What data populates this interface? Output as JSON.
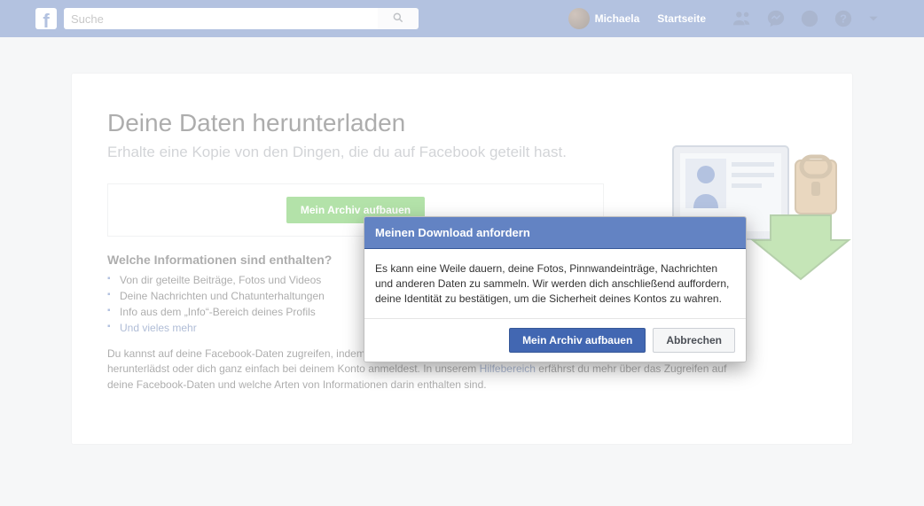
{
  "header": {
    "search_placeholder": "Suche",
    "profile_name": "Michaela",
    "home_label": "Startseite"
  },
  "page": {
    "title": "Deine Daten herunterladen",
    "subtitle": "Erhalte eine Kopie von den Dingen, die du auf Facebook geteilt hast.",
    "archive_button": "Mein Archiv aufbauen",
    "section_heading": "Welche Informationen sind enthalten?",
    "bullets": [
      "Von dir geteilte Beiträge, Fotos und Videos",
      "Deine Nachrichten und Chatunterhaltungen",
      "Info aus dem „Info“-Bereich deines Profils"
    ],
    "bullet_link": "Und vieles mehr",
    "para_part1": "Du kannst auf deine Facebook-Daten zugreifen, indem du dich bei Facebook anmeldest und ein Archiv deiner Informationen herunterlädst oder dich ganz einfach bei deinem Konto anmeldest. In unserem ",
    "para_link": "Hilfebereich",
    "para_part2": " erfährst du mehr über das Zugreifen auf deine Facebook-Daten und welche Arten von Informationen darin enthalten sind."
  },
  "dialog": {
    "title": "Meinen Download anfordern",
    "body": "Es kann eine Weile dauern, deine Fotos, Pinnwandeinträge, Nachrichten und anderen Daten zu sammeln. Wir werden dich anschließend auffordern, deine Identität zu bestätigen, um die Sicherheit deines Kontos zu wahren.",
    "confirm": "Mein Archiv aufbauen",
    "cancel": "Abbrechen"
  }
}
